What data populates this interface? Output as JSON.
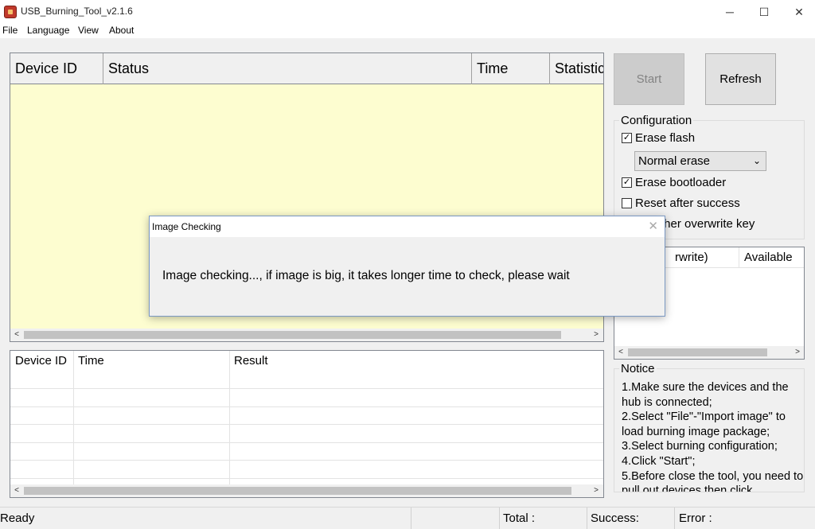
{
  "window": {
    "title": "USB_Burning_Tool_v2.1.6",
    "minimize_glyph": "─",
    "maximize_glyph": "☐",
    "close_glyph": "✕"
  },
  "menu": {
    "file": "File",
    "language": "Language",
    "view": "View",
    "about": "About"
  },
  "device_table": {
    "columns": [
      "Device ID",
      "Status",
      "Time",
      "Statistic"
    ],
    "background": "#fdfdd0",
    "scroll_left": "<",
    "scroll_right": ">"
  },
  "result_table": {
    "columns": [
      "Device ID",
      "Time",
      "Result"
    ]
  },
  "buttons": {
    "start": "Start",
    "refresh": "Refresh"
  },
  "configuration": {
    "title": "Configuration",
    "erase_flash": {
      "label": "Erase flash",
      "checked": true
    },
    "erase_mode": "Normal erase",
    "erase_bootloader": {
      "label": "Erase bootloader",
      "checked": true
    },
    "reset_after_success": {
      "label": "Reset after success",
      "checked": false
    },
    "overwrite_key_partial": "ther overwrite key"
  },
  "key_table": {
    "col1_partial": "rwrite)",
    "col2": "Available"
  },
  "notice": {
    "title": "Notice",
    "text": "1.Make sure the devices and the hub is connected;\n2.Select \"File\"-\"Import image\" to load burning image package;\n3.Select burning configuration;\n4.Click \"Start\";\n5.Before close the tool, you need to pull out devices then click"
  },
  "status": {
    "ready": "Ready",
    "total": "Total :",
    "success": "Success:",
    "error": "Error :"
  },
  "dialog": {
    "title": "Image Checking",
    "message": "Image checking..., if image is big, it takes longer time to check, please wait",
    "close_glyph": "✕"
  },
  "colors": {
    "accent_border": "#7a98c2",
    "grid_yellow": "#fdfdd0",
    "disabled_button": "#cccccc"
  }
}
